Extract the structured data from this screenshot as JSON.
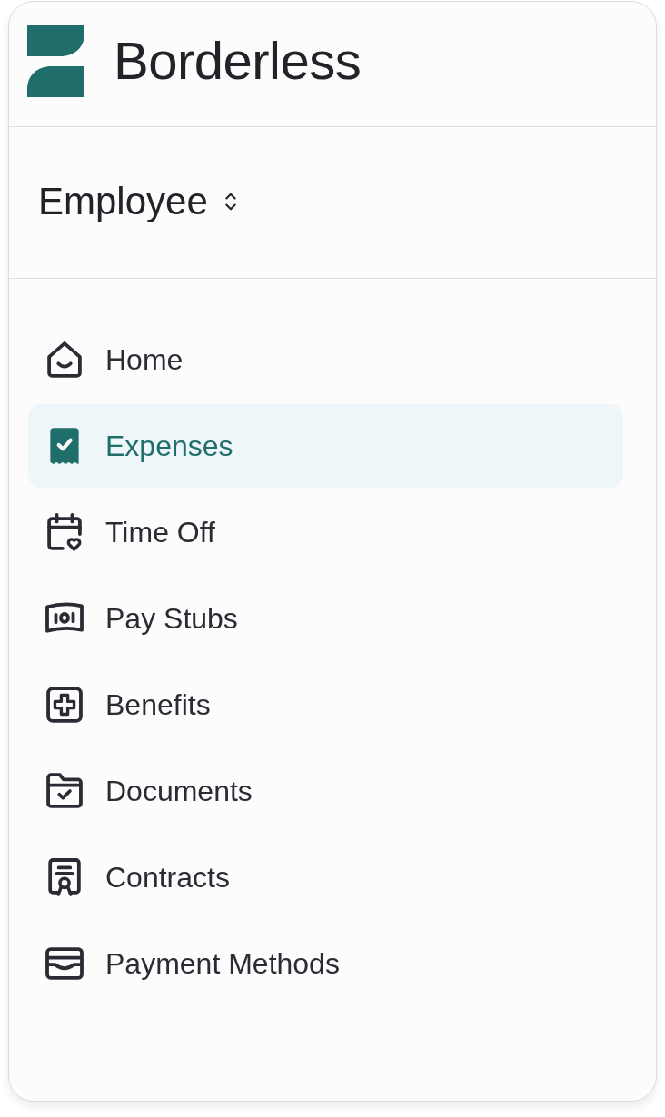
{
  "brand": {
    "name": "Borderless"
  },
  "role_switcher": {
    "label": "Employee"
  },
  "nav": {
    "items": [
      {
        "label": "Home",
        "selected": false
      },
      {
        "label": "Expenses",
        "selected": true
      },
      {
        "label": "Time Off",
        "selected": false
      },
      {
        "label": "Pay Stubs",
        "selected": false
      },
      {
        "label": "Benefits",
        "selected": false
      },
      {
        "label": "Documents",
        "selected": false
      },
      {
        "label": "Contracts",
        "selected": false
      },
      {
        "label": "Payment Methods",
        "selected": false
      }
    ]
  }
}
